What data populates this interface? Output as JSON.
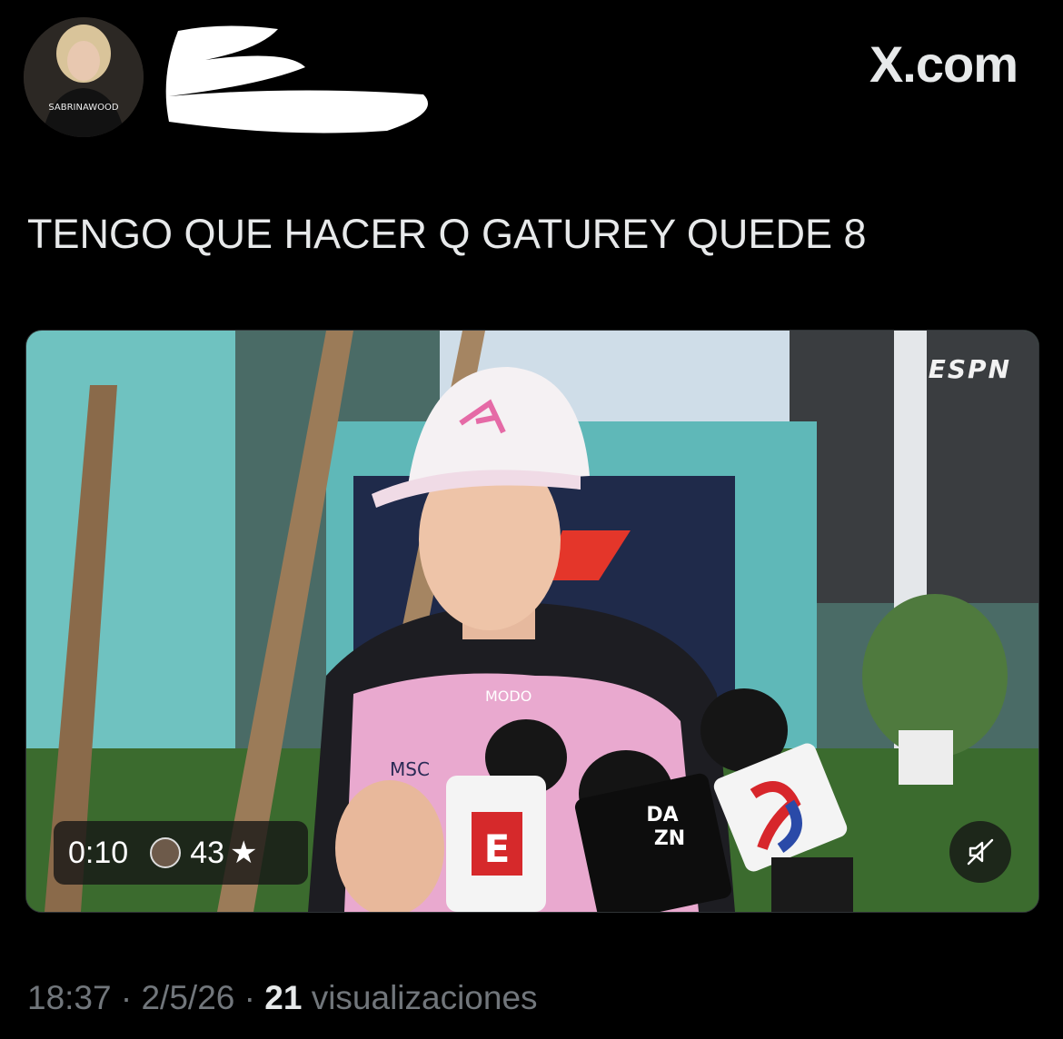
{
  "header": {
    "brand": "X.com",
    "avatar_shirt_text": "SABRINAWOOD"
  },
  "tweet": {
    "text": "TENGO QUE HACER Q GATUREY QUEDE 8"
  },
  "media": {
    "broadcaster_logo": "ESPN",
    "duration": "0:10",
    "favorites_count": "43",
    "star_symbol": "★",
    "mic_labels": [
      "E",
      "DA",
      "ZN"
    ],
    "suit_text": "MSC",
    "suit_text_2": "MODO"
  },
  "meta": {
    "time": "18:37",
    "separator": "·",
    "date": "2/5/26",
    "views_count": "21",
    "views_label": "visualizaciones"
  },
  "colors": {
    "background": "#000000",
    "text": "#e7e9ea",
    "muted": "#71767b"
  }
}
